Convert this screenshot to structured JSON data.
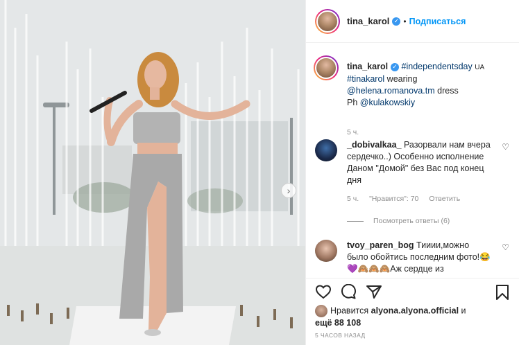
{
  "post": {
    "username": "tina_karol",
    "follow_label": "Подписаться",
    "dot": "•"
  },
  "caption": {
    "username": "tina_karol",
    "hashtag1": "#independentsday",
    "country": "UA",
    "hashtag2": "#tinakarol",
    "text1": " wearing",
    "mention1": "@helena.romanova.tm",
    "text2": " dress",
    "ph": "Ph ",
    "mention2": "@kulakowskiy",
    "time": "5 ч."
  },
  "comments": [
    {
      "username": "_dobivalkaa_",
      "text": " Разорвали нам вчера сердечко..) Особенно исполнение Даном \"Домой\" без Вас под конец дня",
      "time": "5 ч.",
      "likes": "\"Нравится\": 70",
      "reply": "Ответить",
      "view_replies": "Посмотреть ответы (6)"
    },
    {
      "username": "tvoy_paren_bog",
      "text": " Тииии,можно было обойтись последним фото!😂💜🙈🙈🙈Аж сердце из"
    }
  ],
  "likes": {
    "prefix": "Нравится ",
    "user": "alyona.alyona.official",
    "suffix": " и",
    "others": "ещё 88 108"
  },
  "timestamp": "5 ЧАСОВ НАЗАД",
  "icons": {
    "next": "chevron-right-icon",
    "like": "heart-icon",
    "comment": "comment-icon",
    "share": "share-icon",
    "save": "bookmark-icon"
  },
  "colors": {
    "accent": "#0095f6",
    "verified": "#3897f0",
    "link": "#00376b",
    "muted": "#8e8e8e"
  }
}
